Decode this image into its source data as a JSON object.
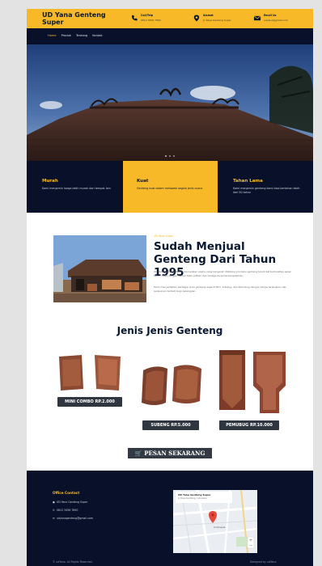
{
  "header": {
    "brand": "UD Yana Genteng Super",
    "contacts": [
      {
        "icon": "phone-icon",
        "label": "Call/Telp",
        "value": "0812 3456 7890"
      },
      {
        "icon": "location-icon",
        "label": "Alamat",
        "value": "Jl. Raya Genteng Super"
      },
      {
        "icon": "email-icon",
        "label": "Email Us",
        "value": "udyana@gmail.com"
      }
    ]
  },
  "nav": {
    "items": [
      "Home",
      "Produk",
      "Tentang",
      "Kontak"
    ]
  },
  "features": [
    {
      "title": "Murah",
      "desc": "Kami menjamin harga lebih murah dari tempat lain"
    },
    {
      "title": "Kuat",
      "desc": "Genteng kuat dalam melawati segala jenis cuaca"
    },
    {
      "title": "Tahan Lama",
      "desc": "Kami menjamin genteng kami bisa bertahan lebih dari 50 tahun"
    }
  ],
  "about": {
    "kicker": "UD Yana Super",
    "title": "Sudah Menjual Genteng Dari Tahun 1995",
    "p1": "UD Yana Genteng Super merupakan usaha yang bergerak dibidang produksi genteng tanah liat berkualitas sejak tahun 1995 dengan bahan baku pilihan dan tenaga kerja berpengalaman.",
    "p2": "Kami menyediakan berbagai jenis genteng seperti Mini, Subeng, dan Pemubug dengan harga terjangkau dan pelayanan terbaik bagi pelanggan."
  },
  "products": {
    "title": "Jenis Jenis Genteng",
    "items": [
      {
        "name": "MINI COMBO RP.2.000"
      },
      {
        "name": "SUBENG RP.5.000"
      },
      {
        "name": "PEMUBUG RP.10.000"
      }
    ],
    "order_label": "PESAN SEKARANG"
  },
  "footer": {
    "office_title": "Office Contact",
    "lines": [
      {
        "icon": "location-icon",
        "text": "UD Yana Genteng Super"
      },
      {
        "icon": "phone-icon",
        "text": "0812 3456 7890"
      },
      {
        "icon": "email-icon",
        "text": "udyanagenteng@gmail.com"
      }
    ],
    "map": {
      "name": "UD Yana Genteng Super",
      "address": "Jl. Raya Genteng, Indonesia",
      "tag": "Indonesia"
    },
    "copyright": "© udYana. All Rights Reserved.",
    "designed": "Designed by udYana"
  },
  "colors": {
    "accent": "#f7b928",
    "navy": "#081129",
    "badge": "#2f3640"
  }
}
